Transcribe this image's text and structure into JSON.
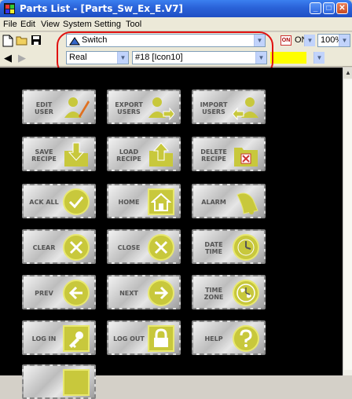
{
  "window": {
    "title": "Parts List - [Parts_Sw_Ex_E.V7]"
  },
  "menu": {
    "file": "File",
    "edit": "Edit",
    "view": "View",
    "system_setting": "System Setting",
    "tool": "Tool"
  },
  "toolbar": {
    "part_type": "Switch",
    "on_label": "ON",
    "zoom": "100%",
    "finish": "Real",
    "icon": "#18 [Icon10]"
  },
  "buttons": [
    {
      "label": "EDIT USER",
      "icon": "user-edit-icon"
    },
    {
      "label": "EXPORT USERS",
      "icon": "user-export-icon"
    },
    {
      "label": "IMPORT USERS",
      "icon": "user-import-icon"
    },
    {
      "label": "SAVE RECIPE",
      "icon": "folder-save-icon"
    },
    {
      "label": "LOAD RECIPE",
      "icon": "folder-load-icon"
    },
    {
      "label": "DELETE RECIPE",
      "icon": "folder-delete-icon"
    },
    {
      "label": "ACK ALL",
      "icon": "check-icon"
    },
    {
      "label": "HOME",
      "icon": "home-icon"
    },
    {
      "label": "ALARM",
      "icon": "bell-icon"
    },
    {
      "label": "CLEAR",
      "icon": "x-circle-icon"
    },
    {
      "label": "CLOSE",
      "icon": "x-circle-icon"
    },
    {
      "label": "DATE TIME",
      "icon": "clock-icon"
    },
    {
      "label": "PREV",
      "icon": "arrow-left-icon"
    },
    {
      "label": "NEXT",
      "icon": "arrow-right-icon"
    },
    {
      "label": "TIME ZONE",
      "icon": "globe-clock-icon"
    },
    {
      "label": "LOG IN",
      "icon": "key-icon"
    },
    {
      "label": "LOG OUT",
      "icon": "lock-icon"
    },
    {
      "label": "HELP",
      "icon": "question-icon"
    }
  ],
  "colors": {
    "accent_yellow": "#c8c83c",
    "highlight_ring": "#e01010",
    "yellow_swatch": "#ffff00"
  }
}
